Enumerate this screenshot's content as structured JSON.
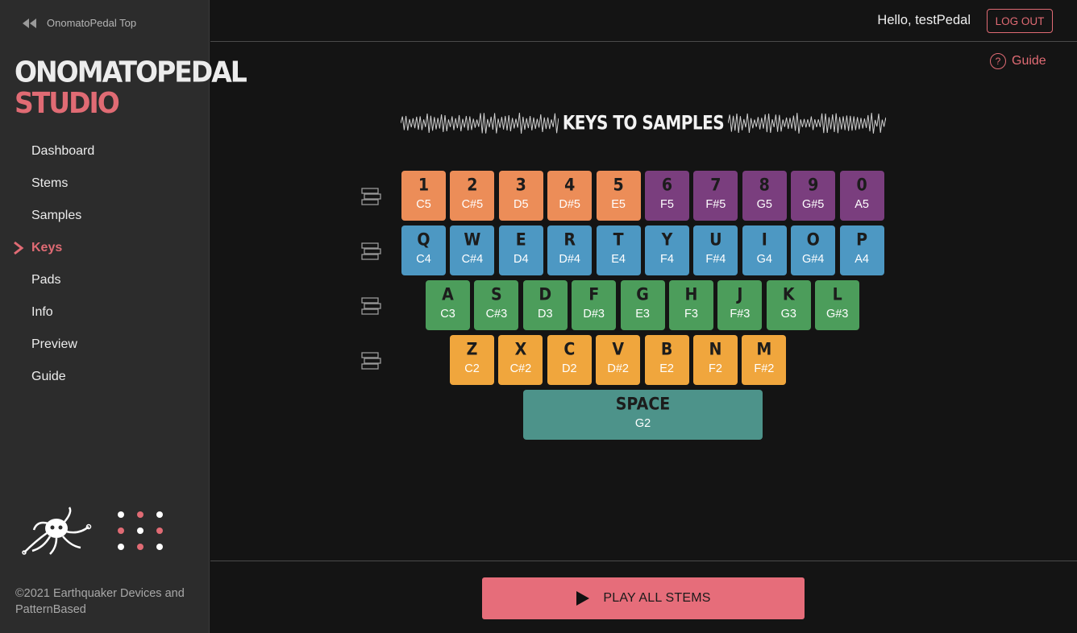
{
  "sidebar": {
    "top_link": "OnomatoPedal Top",
    "brand_line1": "ONOMATOPEDAL",
    "brand_line2": "STUDIO",
    "items": [
      {
        "label": "Dashboard"
      },
      {
        "label": "Stems"
      },
      {
        "label": "Samples"
      },
      {
        "label": "Keys",
        "active": true
      },
      {
        "label": "Pads"
      },
      {
        "label": "Info"
      },
      {
        "label": "Preview"
      },
      {
        "label": "Guide"
      }
    ],
    "copyright": "©2021 Earthquaker Devices and PatternBased"
  },
  "header": {
    "greeting": "Hello, testPedal",
    "logout_label": "LOG OUT"
  },
  "guide_link": "Guide",
  "section_title": "KEYS TO SAMPLES",
  "colors": {
    "accent": "#e06b74",
    "orange": "#ec8d58",
    "purple": "#7a3e7e",
    "blue": "#4d98c3",
    "green": "#4c9d5b",
    "yellow": "#f0a63d",
    "teal": "#4d938a"
  },
  "keyboard": {
    "rows": [
      [
        {
          "key": "1",
          "note": "C5",
          "color": "orange"
        },
        {
          "key": "2",
          "note": "C#5",
          "color": "orange"
        },
        {
          "key": "3",
          "note": "D5",
          "color": "orange"
        },
        {
          "key": "4",
          "note": "D#5",
          "color": "orange"
        },
        {
          "key": "5",
          "note": "E5",
          "color": "orange"
        },
        {
          "key": "6",
          "note": "F5",
          "color": "purple"
        },
        {
          "key": "7",
          "note": "F#5",
          "color": "purple"
        },
        {
          "key": "8",
          "note": "G5",
          "color": "purple"
        },
        {
          "key": "9",
          "note": "G#5",
          "color": "purple"
        },
        {
          "key": "0",
          "note": "A5",
          "color": "purple"
        }
      ],
      [
        {
          "key": "Q",
          "note": "C4",
          "color": "blue"
        },
        {
          "key": "W",
          "note": "C#4",
          "color": "blue"
        },
        {
          "key": "E",
          "note": "D4",
          "color": "blue"
        },
        {
          "key": "R",
          "note": "D#4",
          "color": "blue"
        },
        {
          "key": "T",
          "note": "E4",
          "color": "blue"
        },
        {
          "key": "Y",
          "note": "F4",
          "color": "blue"
        },
        {
          "key": "U",
          "note": "F#4",
          "color": "blue"
        },
        {
          "key": "I",
          "note": "G4",
          "color": "blue"
        },
        {
          "key": "O",
          "note": "G#4",
          "color": "blue"
        },
        {
          "key": "P",
          "note": "A4",
          "color": "blue"
        }
      ],
      [
        {
          "key": "A",
          "note": "C3",
          "color": "green"
        },
        {
          "key": "S",
          "note": "C#3",
          "color": "green"
        },
        {
          "key": "D",
          "note": "D3",
          "color": "green"
        },
        {
          "key": "F",
          "note": "D#3",
          "color": "green"
        },
        {
          "key": "G",
          "note": "E3",
          "color": "green"
        },
        {
          "key": "H",
          "note": "F3",
          "color": "green"
        },
        {
          "key": "J",
          "note": "F#3",
          "color": "green"
        },
        {
          "key": "K",
          "note": "G3",
          "color": "green"
        },
        {
          "key": "L",
          "note": "G#3",
          "color": "green"
        }
      ],
      [
        {
          "key": "Z",
          "note": "C2",
          "color": "yellow"
        },
        {
          "key": "X",
          "note": "C#2",
          "color": "yellow"
        },
        {
          "key": "C",
          "note": "D2",
          "color": "yellow"
        },
        {
          "key": "V",
          "note": "D#2",
          "color": "yellow"
        },
        {
          "key": "B",
          "note": "E2",
          "color": "yellow"
        },
        {
          "key": "N",
          "note": "F2",
          "color": "yellow"
        },
        {
          "key": "M",
          "note": "F#2",
          "color": "yellow"
        }
      ]
    ],
    "space": {
      "key": "SPACE",
      "note": "G2",
      "color": "teal"
    }
  },
  "play_label": "PLAY ALL STEMS"
}
